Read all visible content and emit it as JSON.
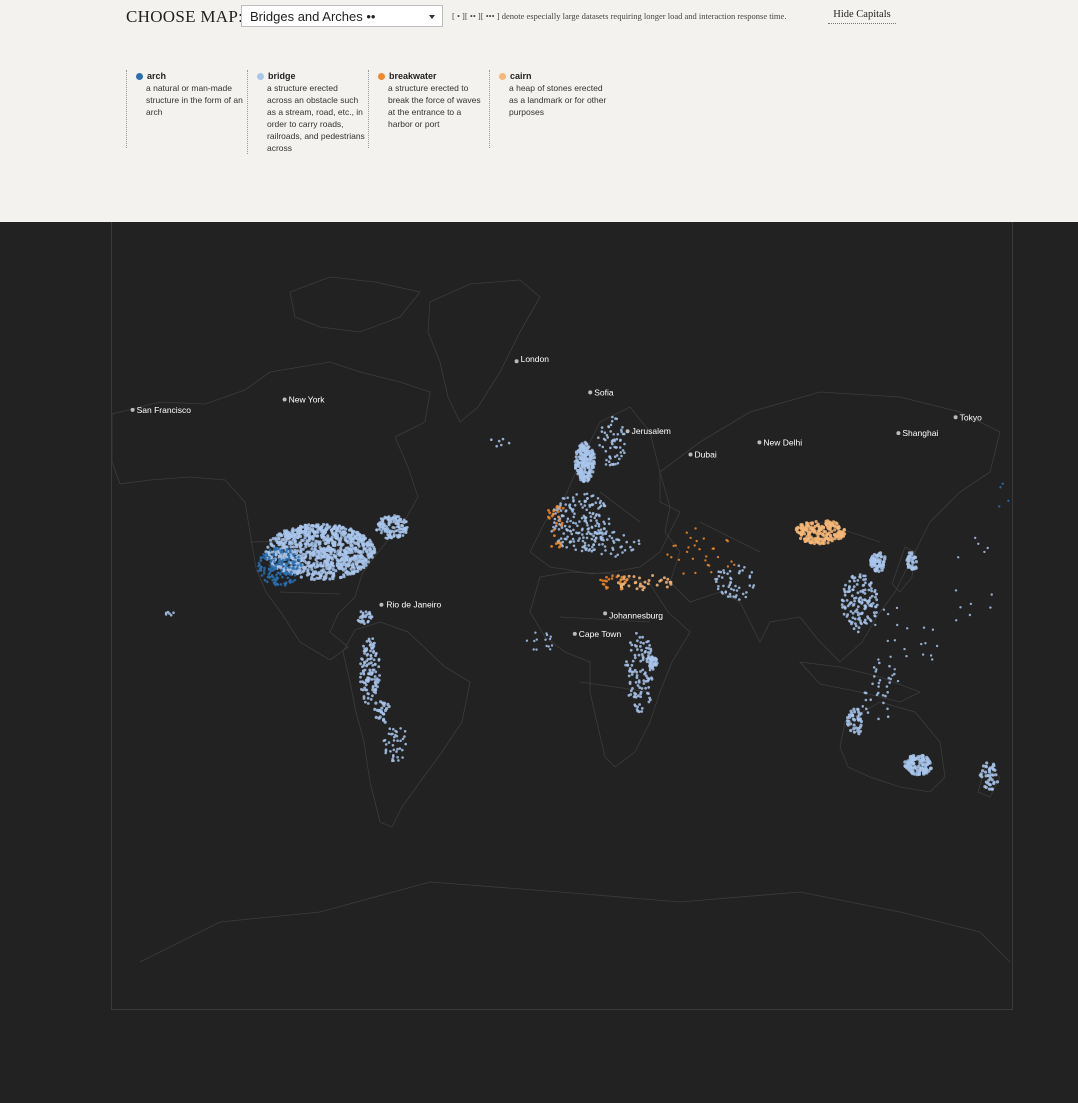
{
  "header": {
    "choose_label": "CHOOSE MAP:",
    "selected_map": "Bridges and Arches ••",
    "size_note": "[ • ][ •• ][ ••• ] denote especially large datasets requiring longer load and interaction response time.",
    "hide_capitals": "Hide Capitals"
  },
  "legend": [
    {
      "name": "arch",
      "color": "#2a6fb0",
      "description": "a natural or man-made structure in the form of an arch"
    },
    {
      "name": "bridge",
      "color": "#a9c6ec",
      "description": "a structure erected across an obstacle such as a stream, road, etc., in order to carry roads, railroads, and pedestrians across"
    },
    {
      "name": "breakwater",
      "color": "#f08a2c",
      "description": "a structure erected to break the force of waves at the entrance to a harbor or port"
    },
    {
      "name": "cairn",
      "color": "#f6b777",
      "description": "a heap of stones erected as a landmark or for other purposes"
    }
  ],
  "map": {
    "background": "#222222",
    "outline_color": "#3c3c3c",
    "cities": [
      {
        "name": "San Francisco",
        "lat": 37.77,
        "lon": -122.42
      },
      {
        "name": "New York",
        "lat": 40.71,
        "lon": -74.0
      },
      {
        "name": "London",
        "lat": 51.5,
        "lon": -0.12
      },
      {
        "name": "Sofia",
        "lat": 42.7,
        "lon": 23.32
      },
      {
        "name": "Jerusalem",
        "lat": 31.77,
        "lon": 35.21
      },
      {
        "name": "Dubai",
        "lat": 25.2,
        "lon": 55.27
      },
      {
        "name": "New Delhi",
        "lat": 28.61,
        "lon": 77.2
      },
      {
        "name": "Shanghai",
        "lat": 31.23,
        "lon": 121.47
      },
      {
        "name": "Tokyo",
        "lat": 35.68,
        "lon": 139.69
      },
      {
        "name": "Rio de Janeiro",
        "lat": -22.9,
        "lon": -43.2
      },
      {
        "name": "Johannesburg",
        "lat": -26.2,
        "lon": 28.05
      },
      {
        "name": "Cape Town",
        "lat": -33.92,
        "lon": 18.42
      }
    ]
  }
}
